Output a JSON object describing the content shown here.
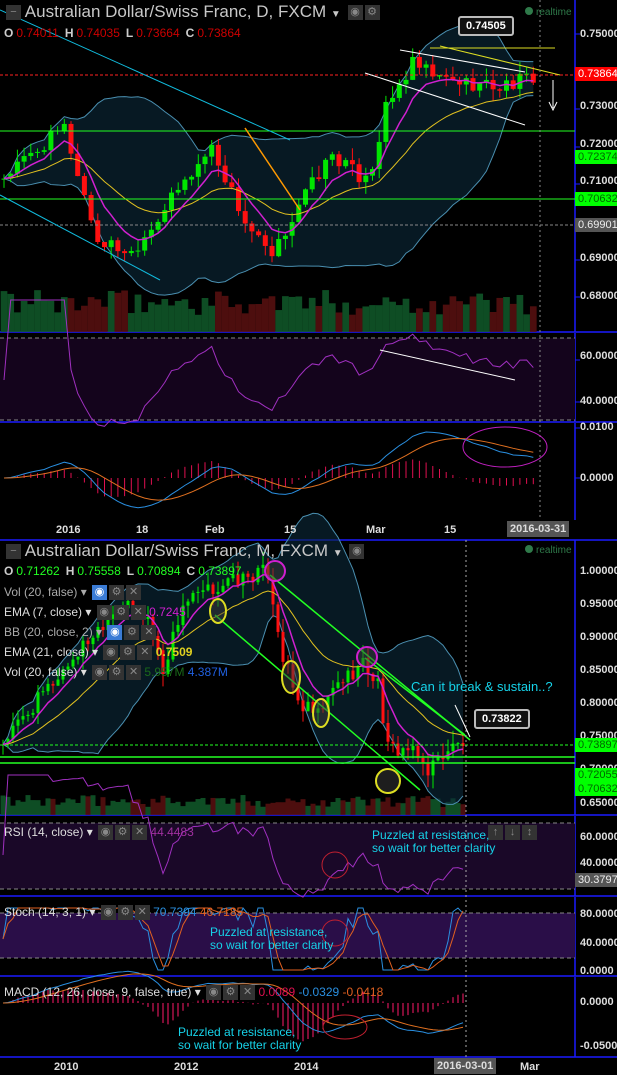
{
  "top": {
    "title": "Australian Dollar/Swiss Franc, D, FXCM",
    "realtime": "realtime",
    "ohlc": {
      "o_label": "O",
      "o": "0.74011",
      "h_label": "H",
      "h": "0.74035",
      "l_label": "L",
      "l": "0.73664",
      "c_label": "C",
      "c": "0.73864"
    },
    "callout": "0.74505",
    "price_axis": [
      "0.75000",
      "0.73000",
      "0.72000",
      "0.71000",
      "0.69000",
      "0.68000"
    ],
    "price_tags": {
      "last": "0.73864",
      "green1": "0.72374",
      "green2": "0.70632",
      "grey": "0.69901"
    },
    "rsi_axis": [
      "60.0000",
      "40.0000"
    ],
    "macd_axis": [
      "0.0100",
      "0.0000"
    ],
    "x_axis": [
      "2016",
      "18",
      "Feb",
      "15",
      "Mar",
      "15"
    ],
    "x_cursor": "2016-03-31"
  },
  "bottom": {
    "title": "Australian Dollar/Swiss Franc, M, FXCM",
    "realtime": "realtime",
    "ohlc": {
      "o_label": "O",
      "o": "0.71262",
      "h_label": "H",
      "h": "0.75558",
      "l_label": "L",
      "l": "0.70894",
      "c_label": "C",
      "c": "0.73897"
    },
    "indicators": [
      {
        "label": "Vol (20, false)",
        "value": ""
      },
      {
        "label": "EMA (7, close)",
        "value": "0.7245"
      },
      {
        "label": "BB (20, close, 2)",
        "value": ""
      },
      {
        "label": "EMA (21, close)",
        "value": "0.7509"
      },
      {
        "label": "Vol (20, false)",
        "value": "5.957M",
        "value2": "4.387M"
      }
    ],
    "question": "Can it break & sustain..?",
    "callout": "0.73822",
    "price_axis": [
      "1.00000",
      "0.95000",
      "0.90000",
      "0.85000",
      "0.80000",
      "0.75000",
      "0.70000",
      "0.65000"
    ],
    "price_tags": {
      "last": "0.73897",
      "green1": "0.72055",
      "green2": "0.70632"
    },
    "rsi": {
      "label": "RSI (14, close)",
      "value": "44.4483",
      "axis": [
        "60.0000",
        "40.0000"
      ],
      "tag": "30.3797"
    },
    "stoch": {
      "label": "Stoch (14, 3, 1)",
      "k": "70.7394",
      "d": "46.7185",
      "axis": [
        "80.0000",
        "40.0000",
        "0.0000"
      ]
    },
    "macd": {
      "label": "MACD (12, 26, close, 9, false, true)",
      "hist": "0.0089",
      "macd": "-0.0329",
      "signal": "-0.0418",
      "axis": [
        "0.0000",
        "-0.0500"
      ]
    },
    "note": "Puzzled at resistance,\nso wait for better clarity",
    "notes": [
      "Puzzled at resistance,",
      "so wait for better clarity"
    ],
    "x_axis": [
      "2010",
      "2012",
      "2014",
      "Mar"
    ],
    "x_cursor": "2016-03-01"
  },
  "colors": {
    "up": "#00e600",
    "down": "#ff1010",
    "ema7": "#d020d0",
    "ema21": "#e0c020",
    "bb": "#4a8fb0",
    "annot": "#16d2e8",
    "axis": "#1a1aff"
  },
  "chart_data": [
    {
      "type": "candlestick",
      "title": "Australian Dollar/Swiss Franc, D, FXCM",
      "candles": 80,
      "keypoints": [
        [
          0,
          0.712
        ],
        [
          9,
          0.725
        ],
        [
          14,
          0.695
        ],
        [
          19,
          0.692
        ],
        [
          31,
          0.72
        ],
        [
          36,
          0.7
        ],
        [
          40,
          0.69
        ],
        [
          44,
          0.705
        ],
        [
          49,
          0.718
        ],
        [
          53,
          0.712
        ],
        [
          55,
          0.715
        ],
        [
          57,
          0.73
        ],
        [
          61,
          0.742
        ],
        [
          65,
          0.738
        ],
        [
          74,
          0.736
        ],
        [
          79,
          0.7386
        ]
      ],
      "ylim": [
        0.675,
        0.756
      ]
    },
    {
      "type": "candlestick",
      "title": "Australian Dollar/Swiss Franc, M, FXCM",
      "candles": 93,
      "keypoints": [
        [
          0,
          0.74
        ],
        [
          23,
          0.95
        ],
        [
          29,
          0.93
        ],
        [
          32,
          0.85
        ],
        [
          36,
          0.95
        ],
        [
          44,
          0.98
        ],
        [
          53,
          1.0
        ],
        [
          56,
          0.87
        ],
        [
          59,
          0.8
        ],
        [
          63,
          0.78
        ],
        [
          67,
          0.83
        ],
        [
          72,
          0.86
        ],
        [
          75,
          0.83
        ],
        [
          77,
          0.73
        ],
        [
          81,
          0.73
        ],
        [
          85,
          0.7
        ],
        [
          89,
          0.73
        ],
        [
          92,
          0.739
        ]
      ],
      "ylim": [
        0.63,
        1.02
      ]
    }
  ]
}
